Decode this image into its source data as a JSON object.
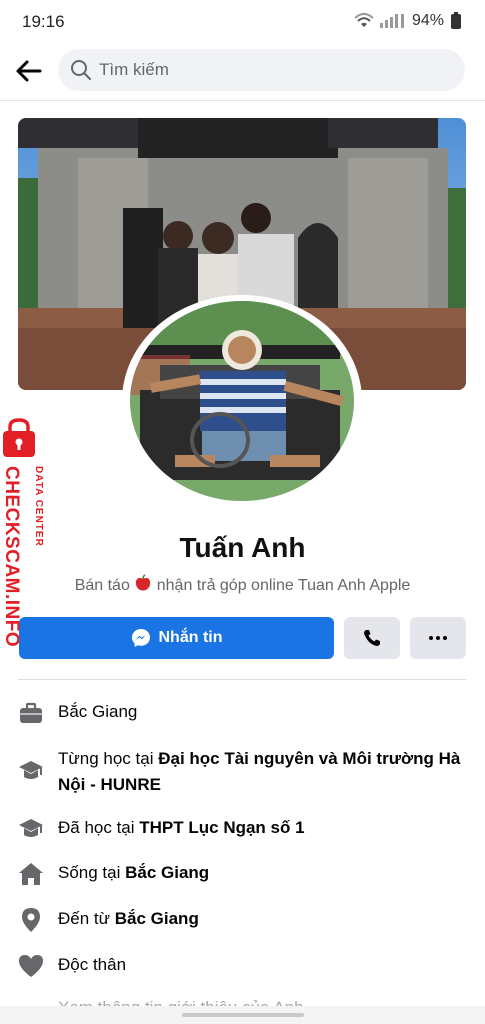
{
  "status_bar": {
    "time": "19:16",
    "battery": "94%"
  },
  "search": {
    "placeholder": "Tìm kiếm"
  },
  "profile": {
    "name": "Tuấn Anh",
    "bio_before": "Bán táo",
    "bio_after": "nhận trả góp online Tuan Anh Apple"
  },
  "actions": {
    "message_label": "Nhắn tin"
  },
  "details": [
    {
      "icon": "briefcase-icon",
      "prefix": "",
      "value": "Bắc Giang"
    },
    {
      "icon": "graduation-cap-icon",
      "prefix": "Từng học tại ",
      "value": "Đại học Tài nguyên và Môi trường Hà Nội - HUNRE"
    },
    {
      "icon": "graduation-cap-icon",
      "prefix": "Đã học tại ",
      "value": "THPT Lục Ngạn số 1"
    },
    {
      "icon": "home-icon",
      "prefix": "Sống tại ",
      "value": "Bắc Giang"
    },
    {
      "icon": "location-pin-icon",
      "prefix": "Đến từ ",
      "value": "Bắc Giang"
    },
    {
      "icon": "heart-icon",
      "prefix": "Độc thân",
      "value": ""
    }
  ],
  "partial_row": "Xem thông tin giới thiệu của Anh",
  "watermark": {
    "line1": "DATA CENTER",
    "line2": "CHECKSCAM.INFO"
  },
  "colors": {
    "accent": "#1b74e4",
    "secondary_button": "#e4e6eb",
    "muted_text": "#65676b"
  }
}
